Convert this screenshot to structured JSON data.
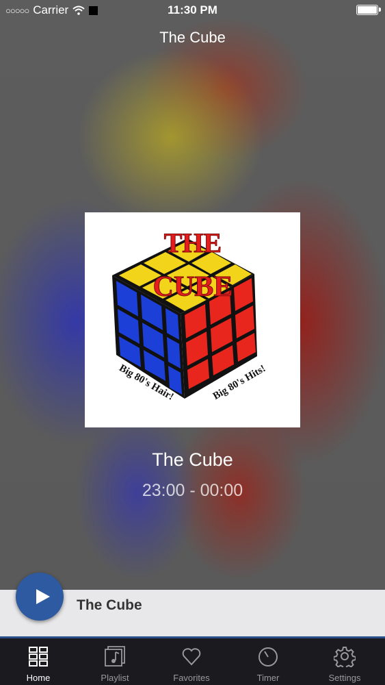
{
  "status_bar": {
    "carrier": "Carrier",
    "time": "11:30 PM"
  },
  "header": {
    "title": "The Cube"
  },
  "now_playing": {
    "station": "The Cube",
    "schedule": "23:00 - 00:00",
    "artwork": {
      "text_line1": "THE",
      "text_line2": "CUBE",
      "tagline_left": "Big 80's Hair!",
      "tagline_right": "Big 80's Hits!"
    }
  },
  "player_bar": {
    "station": "The Cube"
  },
  "tabs": [
    {
      "label": "Home",
      "icon": "grid-icon",
      "active": true
    },
    {
      "label": "Playlist",
      "icon": "music-note-icon",
      "active": false
    },
    {
      "label": "Favorites",
      "icon": "heart-icon",
      "active": false
    },
    {
      "label": "Timer",
      "icon": "timer-icon",
      "active": false
    },
    {
      "label": "Settings",
      "icon": "gear-icon",
      "active": false
    }
  ]
}
